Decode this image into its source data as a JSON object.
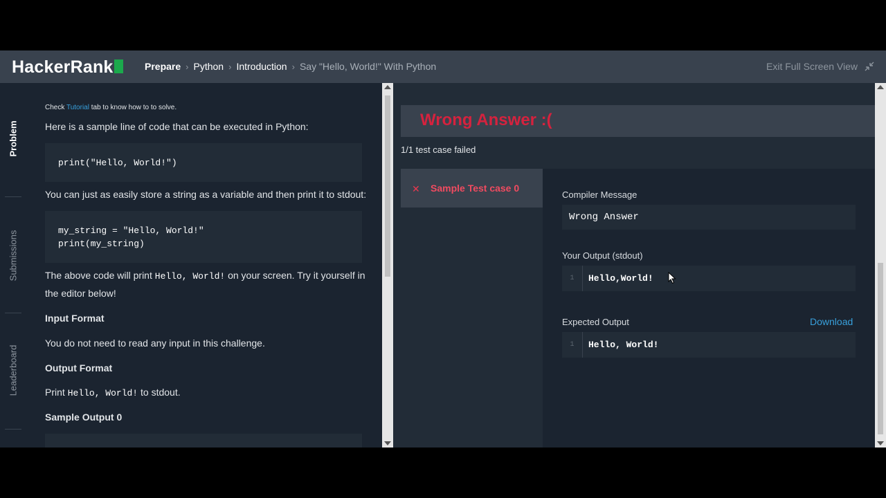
{
  "header": {
    "logo_text": "HackerRank",
    "breadcrumbs": [
      "Prepare",
      "Python",
      "Introduction"
    ],
    "current_page": "Say \"Hello, World!\" With Python",
    "exit_label": "Exit Full Screen View"
  },
  "rail": {
    "items": [
      "Problem",
      "Submissions",
      "Leaderboard"
    ]
  },
  "problem": {
    "hint_prefix": "Check",
    "hint_link": "Tutorial",
    "hint_suffix": "tab to know how to to solve.",
    "intro": "Here is a sample line of code that can be executed in Python:",
    "code1": "print(\"Hello, World!\")",
    "string_text": "You can just as easily store a string as a variable and then print it to stdout:",
    "code2_line1": "my_string = \"Hello, World!\"",
    "code2_line2": "print(my_string)",
    "above_prefix": "The above code will print",
    "above_code": "Hello, World!",
    "above_suffix": "on your screen. Try it yourself in",
    "above_line2": "the editor below!",
    "input_heading": "Input Format",
    "input_text": "You do not need to read any input in this challenge.",
    "output_heading": "Output Format",
    "output_prefix": "Print",
    "output_code": "Hello, World!",
    "output_suffix": "to stdout.",
    "sample_heading": "Sample Output 0"
  },
  "result": {
    "status": "Wrong Answer :(",
    "fail_count": "1/1 test case failed",
    "test_case": "Sample Test case 0",
    "compiler_label": "Compiler Message",
    "compiler_message": "Wrong Answer",
    "your_output_label": "Your Output (stdout)",
    "your_output_line": "1",
    "your_output": "Hello,World!",
    "expected_label": "Expected Output",
    "download_label": "Download",
    "expected_line": "1",
    "expected_output": "Hello, World!"
  },
  "colors": {
    "header_bg": "#39424e",
    "brand_green": "#1ba94c",
    "error_red": "#d5223e",
    "link_blue": "#38a0dc"
  }
}
